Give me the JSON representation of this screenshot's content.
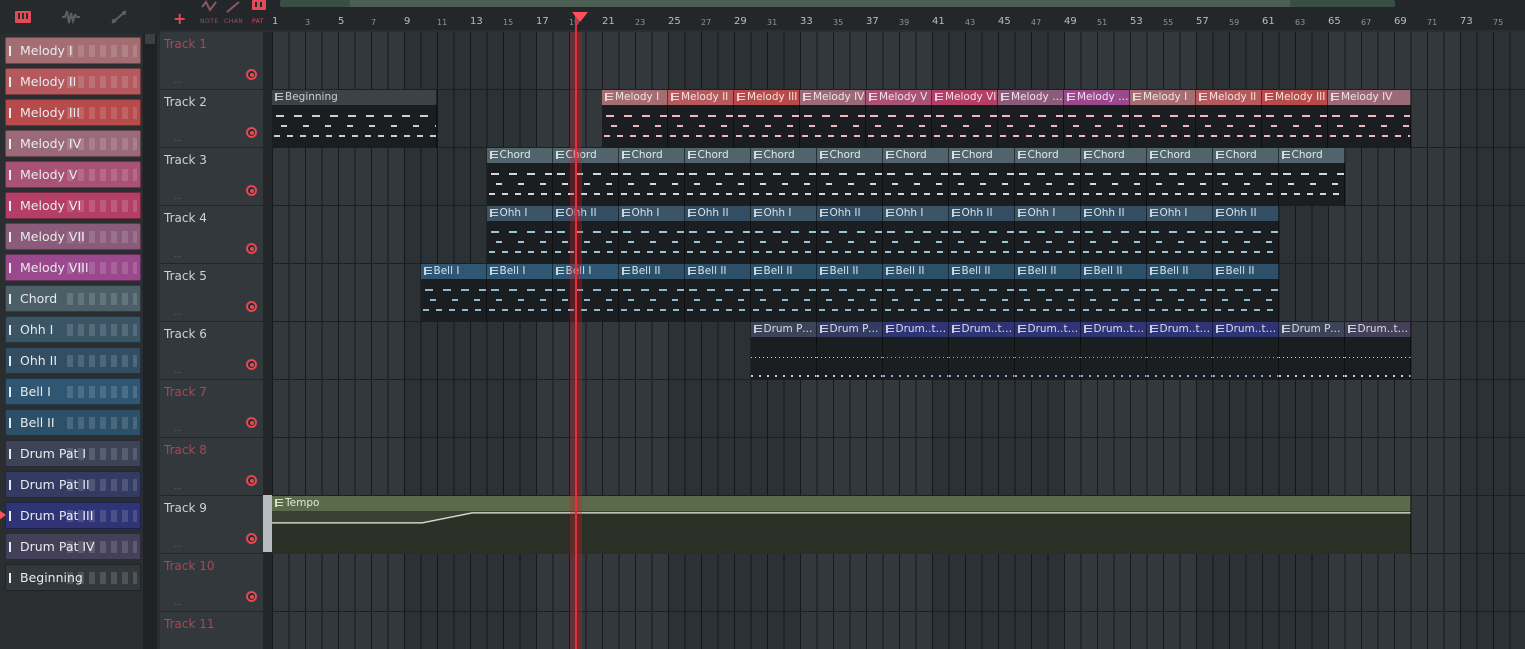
{
  "picker": {
    "toolbar_icons": [
      "pattern-icon",
      "audio-icon",
      "automation-icon"
    ],
    "items": [
      {
        "label": "Melody I",
        "color": "#a36d72"
      },
      {
        "label": "Melody II",
        "color": "#b45a5f"
      },
      {
        "label": "Melody III",
        "color": "#b74a4b"
      },
      {
        "label": "Melody IV",
        "color": "#9a6a78"
      },
      {
        "label": "Melody V",
        "color": "#a85275"
      },
      {
        "label": "Melody VI",
        "color": "#b33f66"
      },
      {
        "label": "Melody VII",
        "color": "#8a5b7a"
      },
      {
        "label": "Melody VIII",
        "color": "#9a4a8c"
      },
      {
        "label": "Chord",
        "color": "#4c5f67"
      },
      {
        "label": "Ohh I",
        "color": "#3b5466"
      },
      {
        "label": "Ohh II",
        "color": "#334e63"
      },
      {
        "label": "Bell I",
        "color": "#2f5673"
      },
      {
        "label": "Bell II",
        "color": "#2c5068"
      },
      {
        "label": "Drum Pat I",
        "color": "#3d4458"
      },
      {
        "label": "Drum Pat II",
        "color": "#343b63"
      },
      {
        "label": "Drum Pat III",
        "color": "#2e3475"
      },
      {
        "label": "Drum Pat IV",
        "color": "#44405a"
      },
      {
        "label": "Beginning",
        "color": "#33383c"
      }
    ],
    "selected": "Drum Pat III"
  },
  "header": {
    "add_label": "+",
    "modes": [
      "NOTE",
      "CHAN",
      "PAT"
    ],
    "ruler": [
      {
        "n": "1",
        "big": true
      },
      {
        "n": "3",
        "big": false
      },
      {
        "n": "5",
        "big": true
      },
      {
        "n": "7",
        "big": false
      },
      {
        "n": "9",
        "big": true
      },
      {
        "n": "11",
        "big": false
      },
      {
        "n": "13",
        "big": true
      },
      {
        "n": "15",
        "big": false
      },
      {
        "n": "17",
        "big": true
      },
      {
        "n": "19",
        "big": false
      },
      {
        "n": "21",
        "big": true
      },
      {
        "n": "23",
        "big": false
      },
      {
        "n": "25",
        "big": true
      },
      {
        "n": "27",
        "big": false
      },
      {
        "n": "29",
        "big": true
      },
      {
        "n": "31",
        "big": false
      },
      {
        "n": "33",
        "big": true
      },
      {
        "n": "35",
        "big": false
      },
      {
        "n": "37",
        "big": true
      },
      {
        "n": "39",
        "big": false
      },
      {
        "n": "41",
        "big": true
      },
      {
        "n": "43",
        "big": false
      },
      {
        "n": "45",
        "big": true
      },
      {
        "n": "47",
        "big": false
      },
      {
        "n": "49",
        "big": true
      },
      {
        "n": "51",
        "big": false
      },
      {
        "n": "53",
        "big": true
      },
      {
        "n": "55",
        "big": false
      },
      {
        "n": "57",
        "big": true
      },
      {
        "n": "59",
        "big": false
      },
      {
        "n": "61",
        "big": true
      },
      {
        "n": "63",
        "big": false
      },
      {
        "n": "65",
        "big": true
      },
      {
        "n": "67",
        "big": false
      },
      {
        "n": "69",
        "big": true
      },
      {
        "n": "71",
        "big": false
      },
      {
        "n": "73",
        "big": true
      },
      {
        "n": "75",
        "big": false
      }
    ]
  },
  "tracks": [
    {
      "name": "Track 1",
      "empty": true,
      "clips": []
    },
    {
      "name": "Track 2",
      "empty": false,
      "clips": [
        {
          "label": "Beginning",
          "start": 1,
          "len": 10,
          "color": "#3c4246",
          "text": "#c9d0d4",
          "note": "#c9d0d4",
          "kind": "notes"
        },
        {
          "label": "Melody I",
          "start": 21,
          "len": 4,
          "color": "#a36d72",
          "text": "#f1e4e6",
          "note": "#f0b7bd",
          "kind": "notes"
        },
        {
          "label": "Melody II",
          "start": 25,
          "len": 4,
          "color": "#b45a5f",
          "text": "#f6e0e1",
          "note": "#f0b7bd",
          "kind": "notes"
        },
        {
          "label": "Melody III",
          "start": 29,
          "len": 4,
          "color": "#b74a4b",
          "text": "#f8dfdf",
          "note": "#f0b7bd",
          "kind": "notes"
        },
        {
          "label": "Melody IV",
          "start": 33,
          "len": 4,
          "color": "#9a6a78",
          "text": "#f0e3e8",
          "note": "#f0b7bd",
          "kind": "notes"
        },
        {
          "label": "Melody V",
          "start": 37,
          "len": 4,
          "color": "#a85275",
          "text": "#f6e0ea",
          "note": "#f0b7bd",
          "kind": "notes"
        },
        {
          "label": "Melody VI",
          "start": 41,
          "len": 4,
          "color": "#b33f66",
          "text": "#f8dde7",
          "note": "#f0b7bd",
          "kind": "notes"
        },
        {
          "label": "Melody VII",
          "start": 45,
          "len": 4,
          "color": "#8a5b7a",
          "text": "#f0e1ec",
          "note": "#f0b7bd",
          "kind": "notes"
        },
        {
          "label": "Melody VIII",
          "start": 49,
          "len": 4,
          "color": "#9a4a8c",
          "text": "#f3dcef",
          "note": "#f0b7bd",
          "kind": "notes"
        },
        {
          "label": "Melody I",
          "start": 53,
          "len": 4,
          "color": "#a36d72",
          "text": "#f1e4e6",
          "note": "#f0b7bd",
          "kind": "notes"
        },
        {
          "label": "Melody II",
          "start": 57,
          "len": 4,
          "color": "#b45a5f",
          "text": "#f6e0e1",
          "note": "#f0b7bd",
          "kind": "notes"
        },
        {
          "label": "Melody III",
          "start": 61,
          "len": 4,
          "color": "#b74a4b",
          "text": "#f8dfdf",
          "note": "#f0b7bd",
          "kind": "notes"
        },
        {
          "label": "Melody IV",
          "start": 65,
          "len": 5,
          "color": "#9a6a78",
          "text": "#f0e3e8",
          "note": "#f0b7bd",
          "kind": "notes"
        }
      ]
    },
    {
      "name": "Track 3",
      "empty": false,
      "clips": [
        {
          "label": "Chord",
          "start": 14,
          "len": 4,
          "color": "#51646c",
          "text": "#e2e9ec",
          "note": "#cfd9de",
          "kind": "notes"
        },
        {
          "label": "Chord",
          "start": 18,
          "len": 4,
          "color": "#51646c",
          "text": "#e2e9ec",
          "note": "#cfd9de",
          "kind": "notes"
        },
        {
          "label": "Chord",
          "start": 22,
          "len": 4,
          "color": "#51646c",
          "text": "#e2e9ec",
          "note": "#cfd9de",
          "kind": "notes"
        },
        {
          "label": "Chord",
          "start": 26,
          "len": 4,
          "color": "#51646c",
          "text": "#e2e9ec",
          "note": "#cfd9de",
          "kind": "notes"
        },
        {
          "label": "Chord",
          "start": 30,
          "len": 4,
          "color": "#51646c",
          "text": "#e2e9ec",
          "note": "#cfd9de",
          "kind": "notes"
        },
        {
          "label": "Chord",
          "start": 34,
          "len": 4,
          "color": "#51646c",
          "text": "#e2e9ec",
          "note": "#cfd9de",
          "kind": "notes"
        },
        {
          "label": "Chord",
          "start": 38,
          "len": 4,
          "color": "#51646c",
          "text": "#e2e9ec",
          "note": "#cfd9de",
          "kind": "notes"
        },
        {
          "label": "Chord",
          "start": 42,
          "len": 4,
          "color": "#51646c",
          "text": "#e2e9ec",
          "note": "#cfd9de",
          "kind": "notes"
        },
        {
          "label": "Chord",
          "start": 46,
          "len": 4,
          "color": "#51646c",
          "text": "#e2e9ec",
          "note": "#cfd9de",
          "kind": "notes"
        },
        {
          "label": "Chord",
          "start": 50,
          "len": 4,
          "color": "#51646c",
          "text": "#e2e9ec",
          "note": "#cfd9de",
          "kind": "notes"
        },
        {
          "label": "Chord",
          "start": 54,
          "len": 4,
          "color": "#51646c",
          "text": "#e2e9ec",
          "note": "#cfd9de",
          "kind": "notes"
        },
        {
          "label": "Chord",
          "start": 58,
          "len": 4,
          "color": "#51646c",
          "text": "#e2e9ec",
          "note": "#cfd9de",
          "kind": "notes"
        },
        {
          "label": "Chord",
          "start": 62,
          "len": 4,
          "color": "#51646c",
          "text": "#e2e9ec",
          "note": "#cfd9de",
          "kind": "notes"
        }
      ]
    },
    {
      "name": "Track 4",
      "empty": false,
      "clips": [
        {
          "label": "Ohh I",
          "start": 14,
          "len": 4,
          "color": "#3b5466",
          "text": "#d5e2ea",
          "note": "#9ec4d8",
          "kind": "notes"
        },
        {
          "label": "Ohh II",
          "start": 18,
          "len": 4,
          "color": "#334e63",
          "text": "#d5e2ea",
          "note": "#9ec4d8",
          "kind": "notes"
        },
        {
          "label": "Ohh I",
          "start": 22,
          "len": 4,
          "color": "#3b5466",
          "text": "#d5e2ea",
          "note": "#9ec4d8",
          "kind": "notes"
        },
        {
          "label": "Ohh II",
          "start": 26,
          "len": 4,
          "color": "#334e63",
          "text": "#d5e2ea",
          "note": "#9ec4d8",
          "kind": "notes"
        },
        {
          "label": "Ohh I",
          "start": 30,
          "len": 4,
          "color": "#3b5466",
          "text": "#d5e2ea",
          "note": "#9ec4d8",
          "kind": "notes"
        },
        {
          "label": "Ohh II",
          "start": 34,
          "len": 4,
          "color": "#334e63",
          "text": "#d5e2ea",
          "note": "#9ec4d8",
          "kind": "notes"
        },
        {
          "label": "Ohh I",
          "start": 38,
          "len": 4,
          "color": "#3b5466",
          "text": "#d5e2ea",
          "note": "#9ec4d8",
          "kind": "notes"
        },
        {
          "label": "Ohh II",
          "start": 42,
          "len": 4,
          "color": "#334e63",
          "text": "#d5e2ea",
          "note": "#9ec4d8",
          "kind": "notes"
        },
        {
          "label": "Ohh I",
          "start": 46,
          "len": 4,
          "color": "#3b5466",
          "text": "#d5e2ea",
          "note": "#9ec4d8",
          "kind": "notes"
        },
        {
          "label": "Ohh II",
          "start": 50,
          "len": 4,
          "color": "#334e63",
          "text": "#d5e2ea",
          "note": "#9ec4d8",
          "kind": "notes"
        },
        {
          "label": "Ohh I",
          "start": 54,
          "len": 4,
          "color": "#3b5466",
          "text": "#d5e2ea",
          "note": "#9ec4d8",
          "kind": "notes"
        },
        {
          "label": "Ohh II",
          "start": 58,
          "len": 4,
          "color": "#334e63",
          "text": "#d5e2ea",
          "note": "#9ec4d8",
          "kind": "notes"
        }
      ]
    },
    {
      "name": "Track 5",
      "empty": false,
      "clips": [
        {
          "label": "Bell I",
          "start": 10,
          "len": 4,
          "color": "#2f5673",
          "text": "#d5e4ef",
          "note": "#8fbad4",
          "kind": "notes"
        },
        {
          "label": "Bell I",
          "start": 14,
          "len": 4,
          "color": "#2f5673",
          "text": "#d5e4ef",
          "note": "#8fbad4",
          "kind": "notes"
        },
        {
          "label": "Bell I",
          "start": 18,
          "len": 4,
          "color": "#2f5673",
          "text": "#d5e4ef",
          "note": "#8fbad4",
          "kind": "notes"
        },
        {
          "label": "Bell II",
          "start": 22,
          "len": 4,
          "color": "#2c5068",
          "text": "#d5e4ef",
          "note": "#8fbad4",
          "kind": "notes"
        },
        {
          "label": "Bell II",
          "start": 26,
          "len": 4,
          "color": "#2c5068",
          "text": "#d5e4ef",
          "note": "#8fbad4",
          "kind": "notes"
        },
        {
          "label": "Bell II",
          "start": 30,
          "len": 4,
          "color": "#2c5068",
          "text": "#d5e4ef",
          "note": "#8fbad4",
          "kind": "notes"
        },
        {
          "label": "Bell II",
          "start": 34,
          "len": 4,
          "color": "#2c5068",
          "text": "#d5e4ef",
          "note": "#8fbad4",
          "kind": "notes"
        },
        {
          "label": "Bell II",
          "start": 38,
          "len": 4,
          "color": "#2c5068",
          "text": "#d5e4ef",
          "note": "#8fbad4",
          "kind": "notes"
        },
        {
          "label": "Bell II",
          "start": 42,
          "len": 4,
          "color": "#2c5068",
          "text": "#d5e4ef",
          "note": "#8fbad4",
          "kind": "notes"
        },
        {
          "label": "Bell II",
          "start": 46,
          "len": 4,
          "color": "#2c5068",
          "text": "#d5e4ef",
          "note": "#8fbad4",
          "kind": "notes"
        },
        {
          "label": "Bell II",
          "start": 50,
          "len": 4,
          "color": "#2c5068",
          "text": "#d5e4ef",
          "note": "#8fbad4",
          "kind": "notes"
        },
        {
          "label": "Bell II",
          "start": 54,
          "len": 4,
          "color": "#2c5068",
          "text": "#d5e4ef",
          "note": "#8fbad4",
          "kind": "notes"
        },
        {
          "label": "Bell II",
          "start": 58,
          "len": 4,
          "color": "#2c5068",
          "text": "#d5e4ef",
          "note": "#8fbad4",
          "kind": "notes"
        }
      ]
    },
    {
      "name": "Track 6",
      "empty": false,
      "clips": [
        {
          "label": "Drum Pat I",
          "start": 30,
          "len": 4,
          "color": "#3d4458",
          "text": "#dadce6",
          "note": "#c9cde0",
          "kind": "dots"
        },
        {
          "label": "Drum Pat II",
          "start": 34,
          "len": 4,
          "color": "#343b63",
          "text": "#dadce6",
          "note": "#c9cde0",
          "kind": "dots"
        },
        {
          "label": "Drum..t III",
          "start": 38,
          "len": 4,
          "color": "#2e3475",
          "text": "#dadce6",
          "note": "#9aa3e6",
          "kind": "dots"
        },
        {
          "label": "Drum..t III",
          "start": 42,
          "len": 4,
          "color": "#2e3475",
          "text": "#dadce6",
          "note": "#9aa3e6",
          "kind": "dots"
        },
        {
          "label": "Drum..t III",
          "start": 46,
          "len": 4,
          "color": "#2e3475",
          "text": "#dadce6",
          "note": "#9aa3e6",
          "kind": "dots"
        },
        {
          "label": "Drum..t III",
          "start": 50,
          "len": 4,
          "color": "#2e3475",
          "text": "#dadce6",
          "note": "#9aa3e6",
          "kind": "dots"
        },
        {
          "label": "Drum..t III",
          "start": 54,
          "len": 4,
          "color": "#2e3475",
          "text": "#dadce6",
          "note": "#9aa3e6",
          "kind": "dots"
        },
        {
          "label": "Drum..t III",
          "start": 58,
          "len": 4,
          "color": "#2e3475",
          "text": "#dadce6",
          "note": "#9aa3e6",
          "kind": "dots"
        },
        {
          "label": "Drum Pat I",
          "start": 62,
          "len": 4,
          "color": "#3d4458",
          "text": "#dadce6",
          "note": "#c9cde0",
          "kind": "dots"
        },
        {
          "label": "Drum..t IV",
          "start": 66,
          "len": 4,
          "color": "#44405a",
          "text": "#dadce6",
          "note": "#c9cde0",
          "kind": "dots"
        }
      ]
    },
    {
      "name": "Track 7",
      "empty": true,
      "clips": []
    },
    {
      "name": "Track 8",
      "empty": true,
      "clips": []
    },
    {
      "name": "Track 9",
      "empty": false,
      "clips": [
        {
          "label": "Tempo",
          "start": 1,
          "len": 69,
          "color": "#5a6a4a",
          "text": "#e3ead9",
          "kind": "automation"
        }
      ]
    },
    {
      "name": "Track 10",
      "empty": true,
      "clips": []
    },
    {
      "name": "Track 11",
      "empty": true,
      "clips": []
    }
  ]
}
